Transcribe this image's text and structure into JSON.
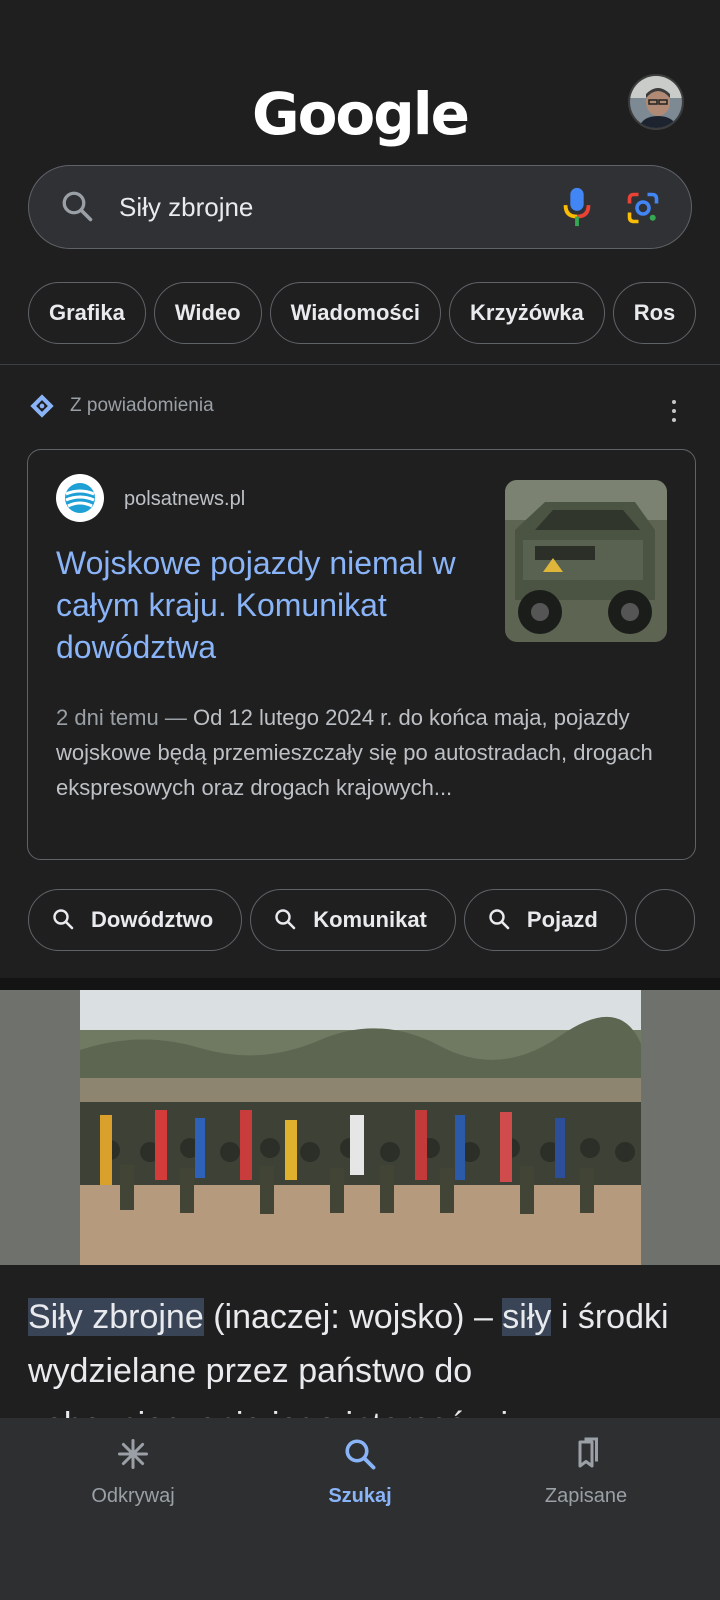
{
  "header": {
    "logo_text": "Google",
    "avatar_alt": "profile"
  },
  "search": {
    "query": "Siły zbrojne"
  },
  "chips": [
    "Grafika",
    "Wideo",
    "Wiadomości",
    "Krzyżówka",
    "Ros"
  ],
  "notification": {
    "label": "Z powiadomienia"
  },
  "card": {
    "site": "polsatnews.pl",
    "headline": "Wojskowe pojazdy niemal w całym kraju. Komunikat dowództwa",
    "date": "2 dni temu",
    "separator": " — ",
    "snippet": "Od 12 lutego 2024 r. do końca maja, pojazdy wojskowe będą przemieszczały się po autostradach, drogach ekspresowych oraz drogach krajowych..."
  },
  "related_searches": [
    "Dowództwo",
    "Komunikat",
    "Pojazd"
  ],
  "wiki": {
    "hl1": "Siły zbrojne",
    "text1": " (inaczej: wojsko) – ",
    "hl2": "siły",
    "text2": " i środki wydzielane przez państwo do zabezpieczenia jego interesów i"
  },
  "bottom_nav": {
    "discover": "Odkrywaj",
    "search": "Szukaj",
    "saved": "Zapisane"
  },
  "colors": {
    "background": "#1f1f1f",
    "link": "#8ab4f8",
    "accent_active": "#8ab4f8"
  }
}
